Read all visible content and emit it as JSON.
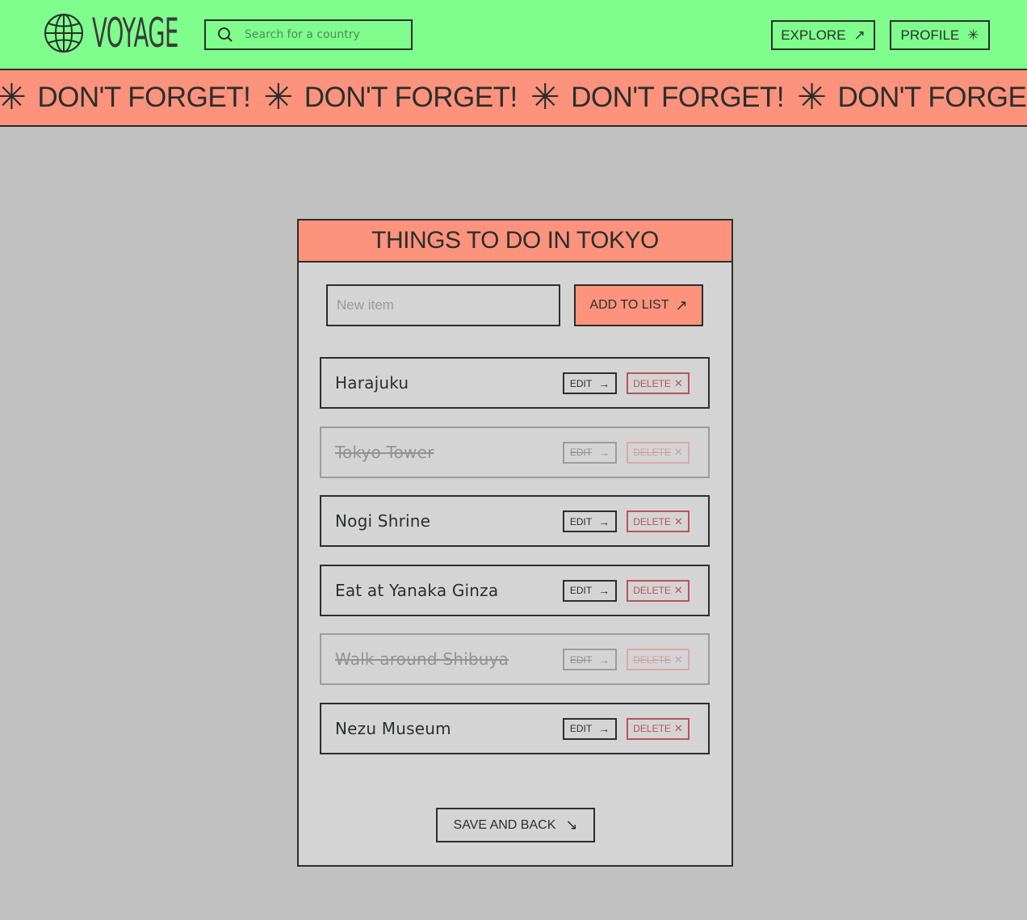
{
  "header": {
    "brand": "VOYAGE",
    "logo_icon": "globe-icon",
    "search": {
      "placeholder": "Search for a country",
      "value": "",
      "icon": "search-icon"
    },
    "nav": [
      {
        "label": "EXPLORE",
        "icon": "arrow-up-right-icon",
        "glyph": "↗"
      },
      {
        "label": "PROFILE",
        "icon": "asterisk-icon",
        "glyph": "✳"
      }
    ]
  },
  "marquee": {
    "text": "DON'T FORGET!",
    "separator_icon": "asterisk-icon",
    "separator_glyph": "✳",
    "repeat": [
      "DON'T FORGET!",
      "DON'T FORGET!",
      "DON'T FORGET!",
      "DON'T FORGET!"
    ]
  },
  "card": {
    "title": "THINGS TO DO IN TOKYO",
    "new_item": {
      "placeholder": "New item",
      "value": ""
    },
    "add_button": {
      "label": "ADD TO LIST",
      "icon": "arrow-up-right-icon",
      "glyph": "↗"
    },
    "items": [
      {
        "label": "Harajuku",
        "done": false
      },
      {
        "label": "Tokyo Tower",
        "done": true
      },
      {
        "label": "Nogi Shrine",
        "done": false
      },
      {
        "label": "Eat at Yanaka Ginza",
        "done": false
      },
      {
        "label": "Walk around Shibuya",
        "done": true
      },
      {
        "label": "Nezu Museum",
        "done": false
      }
    ],
    "edit_label": "EDIT",
    "edit_glyph": "→",
    "delete_label": "DELETE",
    "delete_glyph": "✕",
    "save_button": {
      "label": "SAVE AND BACK",
      "icon": "arrow-down-right-icon",
      "glyph": "↘"
    }
  },
  "colors": {
    "header_bg": "#7ffe8d",
    "accent_salmon": "#fd937d",
    "page_bg": "#c1c1c1",
    "card_bg": "#d4d4d4",
    "text_dark": "#2a2f2c",
    "delete_red": "#b85458"
  }
}
